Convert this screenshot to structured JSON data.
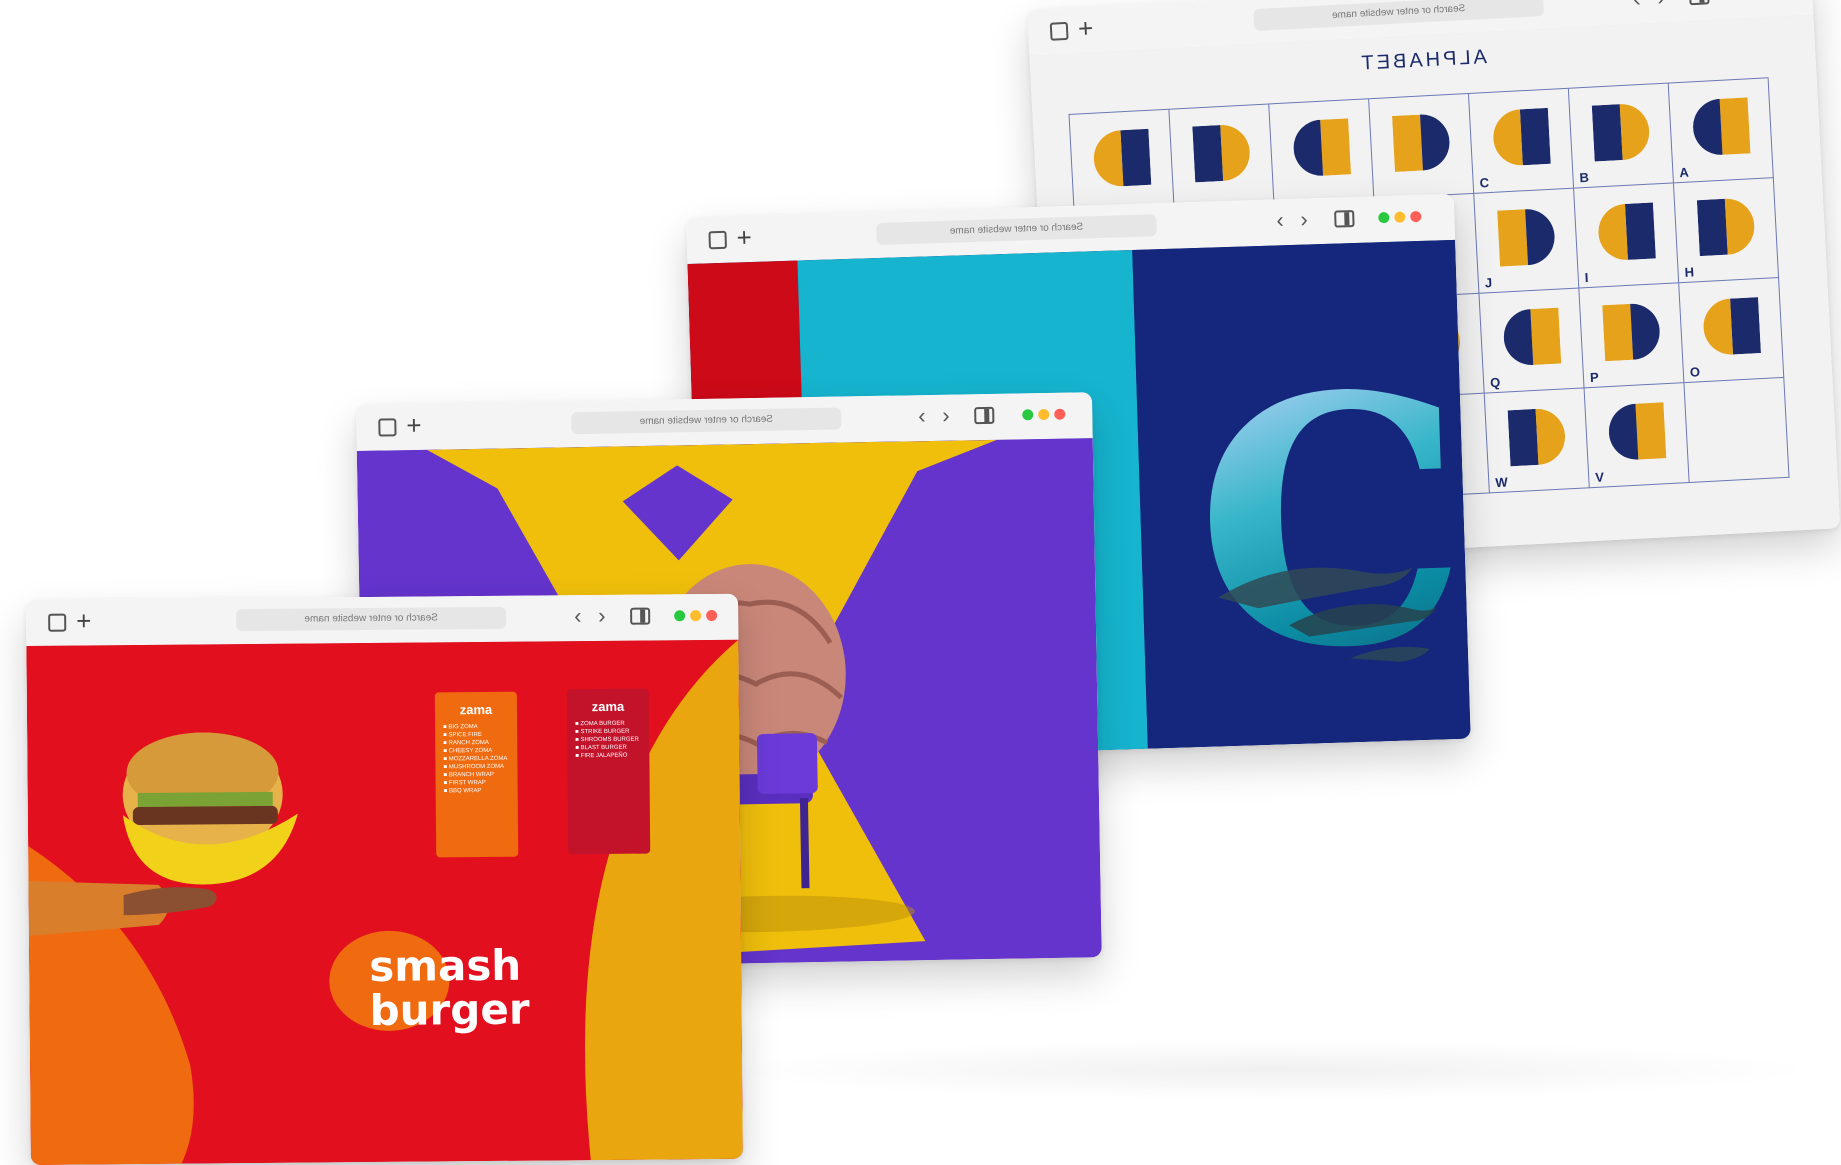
{
  "browser": {
    "url_placeholder": "Search or enter website name",
    "new_tab_symbol": "+",
    "back_symbol": "‹",
    "forward_symbol": "›"
  },
  "windows": {
    "alphabet": {
      "title": "ALPHABET",
      "cells": [
        {
          "label": "",
          "icon": "letter-d-glyph"
        },
        {
          "label": "",
          "icon": "letter-e-glyph"
        },
        {
          "label": "",
          "icon": "letter-f-glyph"
        },
        {
          "label": "",
          "icon": "letter-g-glyph"
        },
        {
          "label": "C",
          "icon": "letter-c-glyph"
        },
        {
          "label": "B",
          "icon": "letter-b-glyph"
        },
        {
          "label": "A",
          "icon": "letter-a-glyph"
        },
        {
          "label": "",
          "icon": "letter-k-glyph"
        },
        {
          "label": "",
          "icon": "letter-l-glyph"
        },
        {
          "label": "",
          "icon": "letter-m-glyph"
        },
        {
          "label": "",
          "icon": "letter-n-glyph"
        },
        {
          "label": "J",
          "icon": "letter-j-glyph"
        },
        {
          "label": "I",
          "icon": "letter-i-glyph"
        },
        {
          "label": "H",
          "icon": "letter-h-glyph"
        },
        {
          "label": "",
          "icon": "letter-r-glyph"
        },
        {
          "label": "",
          "icon": "letter-s-glyph"
        },
        {
          "label": "",
          "icon": "letter-t-glyph"
        },
        {
          "label": "",
          "icon": "letter-u-glyph"
        },
        {
          "label": "Q",
          "icon": "letter-q-glyph"
        },
        {
          "label": "P",
          "icon": "letter-p-glyph"
        },
        {
          "label": "O",
          "icon": "letter-o-glyph"
        },
        {
          "label": "",
          "icon": "letter-y-glyph"
        },
        {
          "label": "",
          "icon": "letter-z-glyph"
        },
        {
          "label": "",
          "icon": "blank"
        },
        {
          "label": "",
          "icon": "blank"
        },
        {
          "label": "W",
          "icon": "letter-w-glyph"
        },
        {
          "label": "V",
          "icon": "letter-v-glyph"
        },
        {
          "label": "",
          "icon": "blank"
        }
      ]
    },
    "dolphin_c": {
      "letter": "C",
      "image": "dolphins-underwater"
    },
    "brain_x": {
      "image": "brain-on-chair"
    },
    "burger": {
      "headline_line1": "smash",
      "headline_line2": "burger",
      "image": "hand-holding-burger",
      "menus": [
        {
          "brand": "zama",
          "items": [
            "BIG ZOMA",
            "SPICE FIRE",
            "RANCH ZOMA",
            "CHEESY ZOMA",
            "MOZZARELLA ZOMA",
            "MUSHROOM ZOMA",
            "BRANCH WRAP",
            "FIRST WRAP",
            "BBQ WRAP"
          ],
          "color": "#f06a10"
        },
        {
          "brand": "zama",
          "items": [
            "ZOMA BURGER",
            "STRIKE BURGER",
            "SHROOMS BURGER",
            "BLAST BURGER",
            "FIRE JALAPEÑO"
          ],
          "color": "#c3132b"
        }
      ]
    }
  },
  "colors": {
    "navy": "#1b2a6b",
    "mustard": "#e6a21b",
    "red": "#e2101e",
    "cyan": "#16b4cf",
    "purple": "#6434cc",
    "yellow": "#f0bf0c",
    "orange": "#f06a10",
    "traffic_green": "#28c840",
    "traffic_yellow": "#febc2e",
    "traffic_red": "#ff5f57"
  }
}
